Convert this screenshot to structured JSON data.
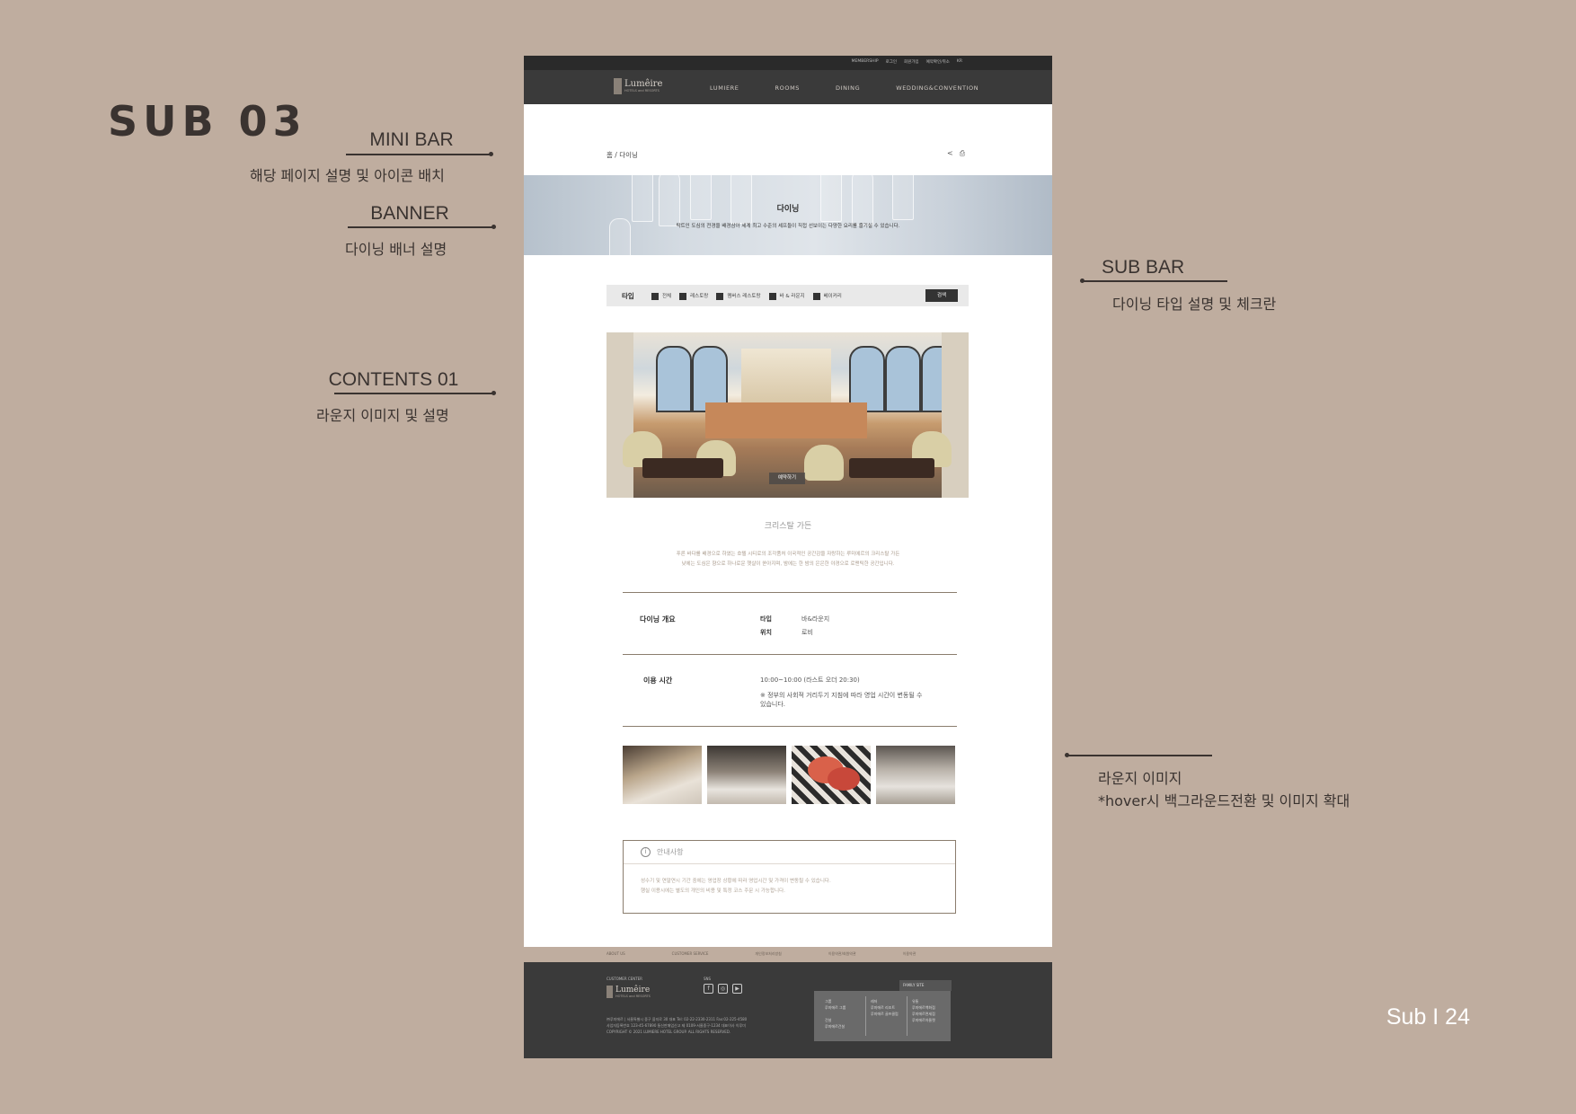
{
  "sheet": {
    "title": "SUB 03",
    "page_number": "Sub I 24"
  },
  "annotations": {
    "mini_bar": {
      "heading": "MINI BAR",
      "desc": "해당 페이지 설명 및 아이콘 배치"
    },
    "banner": {
      "heading": "BANNER",
      "desc": "다이닝 배너 설명"
    },
    "contents01": {
      "heading": "CONTENTS 01",
      "desc": "라운지 이미지 및 설명"
    },
    "sub_bar": {
      "heading": "SUB BAR",
      "desc": "다이닝 타입 설명 및 체크란"
    },
    "lounge_images": {
      "desc1": "라운지 이미지",
      "desc2": "*hover시 백그라운드전환 및 이미지 확대"
    }
  },
  "site": {
    "top_links": [
      "MEMBERSHIP",
      "로그인",
      "회원가입",
      "예약확인/취소",
      "KR"
    ],
    "logo": {
      "name": "Lumêire",
      "sub": "HOTELS and RESORTS"
    },
    "nav": [
      "LUMIERE",
      "ROOMS",
      "DINING",
      "WEDDING&CONVENTION"
    ],
    "breadcrumb": "홈 / 다이닝",
    "mini_icons": [
      "share-icon",
      "print-icon"
    ],
    "banner": {
      "title": "다이닝",
      "desc": "탁트인 도심의 전경을 배경삼아 세계 최고 수준의 셰프들이 직접 선보이는 다양한 요리를 즐기실 수 있습니다."
    },
    "subbar": {
      "label": "타입",
      "options": [
        "전체",
        "레스토랑",
        "멤버스 레스토랑",
        "바 & 라운지",
        "베이커리"
      ],
      "search": "검색"
    },
    "lounge": {
      "reserve": "예약하기",
      "name": "크리스탈 가든",
      "desc_lines": [
        "푸른 바다를 배경으로 하였는 호텔 시티로의 조각품처 이국적인 공간감을 자랑하는 루미에르의 크리스탈 가든",
        "낮에는 도심은 향으로 하나로운 햇살이 쏟아지며, 밤에는 한 밤의 은은한 야경으로 로맨틱한 공간입니다."
      ]
    },
    "overview": {
      "heading": "다이닝 개요",
      "rows": [
        {
          "key": "타입",
          "value": "바&라운지"
        },
        {
          "key": "위치",
          "value": "로비"
        }
      ]
    },
    "hours": {
      "heading": "이용 시간",
      "time": "10:00~10:00 (라스트 오더 20:30)",
      "note_line1": "※ 정부의 사회적 거리두기 지침에 따라 영업 시간이 변동될 수",
      "note_line2": "있습니다."
    },
    "notice": {
      "title": "안내사항",
      "lines": [
        "성수기 및 연말연시 기간 중에는 영업장 상황에 따라 영업시간 및 가격이 변동될 수 있습니다.",
        "행실 이용시에는 별도의 개인의 비용 및 특정 코스 주문 시 가능합니다."
      ]
    },
    "footer_strip": [
      "ABOUT US",
      "CUSTOMER SERVICE",
      "개인정보처리방침",
      "이용약관/회원약관",
      "이용약관"
    ],
    "footer": {
      "customer_center": "CUSTOMER CENTER",
      "sns_label": "SNS",
      "sns": [
        "f",
        "◎",
        "▶"
      ],
      "address_lines": [
        "㈜루미에르 | 서울특별시 중구 을지로 30 대표 Tel: 02-22-2330-2311 Fax:02-225-4580",
        "사업자등록번호 123-45-67890 통신판매업신고 제 0109-서울중구-1234 대표이사 이루미",
        "COPYRIGHT © 2021 LUMIERE HOTEL GROUP. ALL RIGHTS RESERVED."
      ],
      "family_site": "FAMILY SITE",
      "family_cols": [
        [
          "그룹",
          "루미에르 그룹",
          "",
          "건설",
          "루미에르건설"
        ],
        [
          "레저",
          "루미에르 리조트",
          "루미에르 골프클럽"
        ],
        [
          "유통",
          "루미에르백화점",
          "루미에르면세점",
          "루미에르아울렛"
        ]
      ]
    }
  }
}
